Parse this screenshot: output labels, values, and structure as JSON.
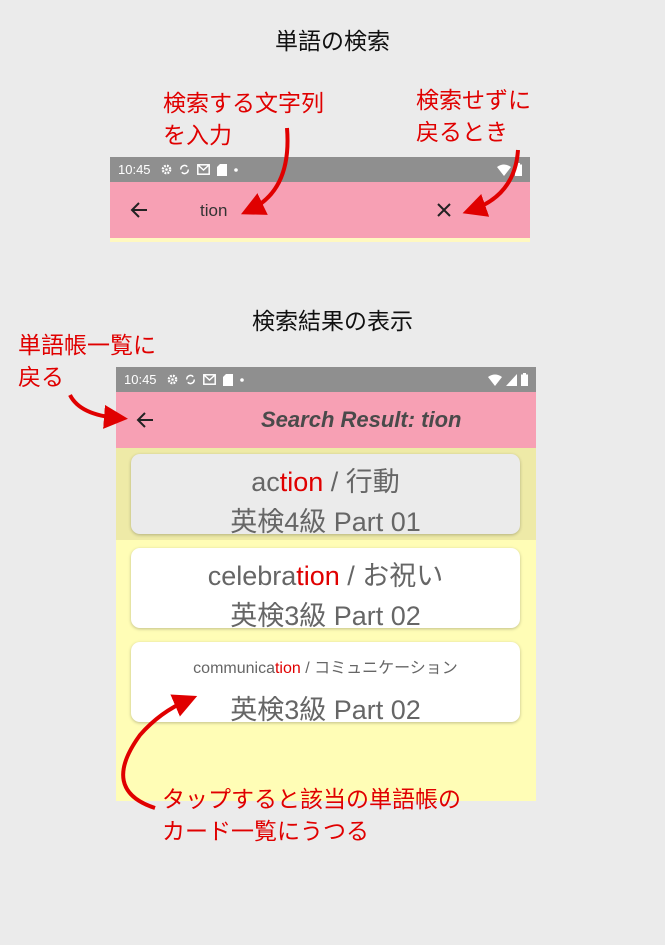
{
  "section1": {
    "title": "単語の検索"
  },
  "annotations": {
    "enter_text": "検索する文字列\nを入力",
    "cancel": "検索せずに\n戻るとき",
    "back_to_list": "単語帳一覧に\n戻る",
    "tap_card": "タップすると該当の単語帳の\nカード一覧にうつる"
  },
  "search_screen": {
    "status_time": "10:45",
    "query": "tion"
  },
  "section2": {
    "title": "検索結果の表示"
  },
  "results_screen": {
    "status_time": "10:45",
    "title": "Search Result: tion",
    "cards": [
      {
        "pre": "ac",
        "match": "tion",
        "post": " / 行動",
        "deck": "英検4級 Part 01"
      },
      {
        "pre": "celebra",
        "match": "tion",
        "post": " / お祝い",
        "deck": "英検3級 Part 02"
      },
      {
        "pre": "communica",
        "match": "tion",
        "post": " / コミュニケーション",
        "deck": "英検3級 Part 02"
      }
    ]
  },
  "colors": {
    "accent_red": "#e00000",
    "toolbar_pink": "#f7a0b4",
    "list_yellow": "#fffdb6",
    "status_gray": "#8f8f8f"
  },
  "icons": [
    "back-arrow-icon",
    "close-icon",
    "settings-icon",
    "sync-icon",
    "mail-icon",
    "sd-card-icon",
    "wifi-icon",
    "signal-icon",
    "battery-icon"
  ]
}
